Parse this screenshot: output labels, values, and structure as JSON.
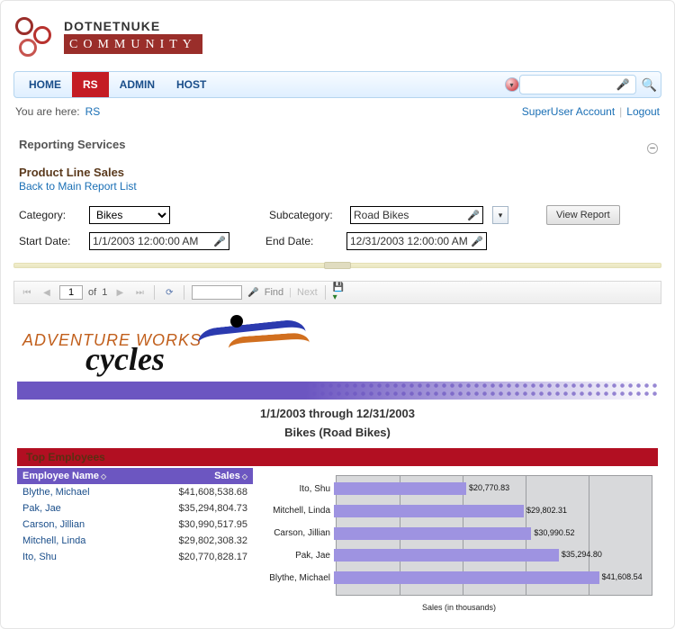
{
  "logo": {
    "line1": "DOTNETNUKE",
    "line2": "COMMUNITY"
  },
  "nav": {
    "items": [
      "HOME",
      "RS",
      "ADMIN",
      "HOST"
    ],
    "active": "RS"
  },
  "breadcrumb": {
    "label": "You are here:",
    "current": "RS"
  },
  "account": {
    "user": "SuperUser Account",
    "logout": "Logout"
  },
  "module_title": "Reporting Services",
  "report": {
    "title": "Product Line Sales",
    "back_link": "Back to Main Report List",
    "params": {
      "category_label": "Category:",
      "category_value": "Bikes",
      "subcategory_label": "Subcategory:",
      "subcategory_value": "Road Bikes",
      "start_label": "Start Date:",
      "start_value": "1/1/2003 12:00:00 AM",
      "end_label": "End Date:",
      "end_value": "12/31/2003 12:00:00 AM",
      "view_button": "View Report"
    }
  },
  "toolbar": {
    "page_value": "1",
    "of": "of",
    "total_pages": "1",
    "find": "Find",
    "next": "Next"
  },
  "adventure": {
    "line1": "Adventure Works",
    "line2": "cycles"
  },
  "report_body": {
    "date_range": "1/1/2003 through 12/31/2003",
    "subtitle": "Bikes (Road Bikes)",
    "top_employees_label": "Top Employees",
    "columns": {
      "name": "Employee Name",
      "sales": "Sales"
    },
    "rows": [
      {
        "name": "Blythe, Michael",
        "sales": "$41,608,538.68"
      },
      {
        "name": "Pak, Jae",
        "sales": "$35,294,804.73"
      },
      {
        "name": "Carson, Jillian",
        "sales": "$30,990,517.95"
      },
      {
        "name": "Mitchell, Linda",
        "sales": "$29,802,308.32"
      },
      {
        "name": "Ito, Shu",
        "sales": "$20,770,828.17"
      }
    ]
  },
  "chart_data": {
    "type": "bar",
    "orientation": "horizontal",
    "title": "",
    "xlabel": "Sales (in thousands)",
    "ylabel": "",
    "xlim": [
      0,
      50000
    ],
    "categories": [
      "Ito, Shu",
      "Mitchell, Linda",
      "Carson, Jillian",
      "Pak, Jae",
      "Blythe, Michael"
    ],
    "values": [
      20770.83,
      29802.31,
      30990.52,
      35294.8,
      41608.54
    ],
    "value_labels": [
      "$20,770.83",
      "$29,802.31",
      "$30,990.52",
      "$35,294.80",
      "$41,608.54"
    ]
  }
}
